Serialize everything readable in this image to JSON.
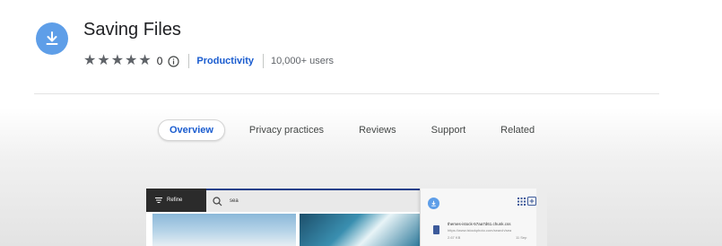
{
  "header": {
    "title": "Saving Files",
    "rating": {
      "stars_filled": 0,
      "stars_total": 5,
      "count": "0"
    },
    "category": "Productivity",
    "users": "10,000+ users",
    "accent_color": "#5e9ee8",
    "link_color": "#1a5ccf",
    "icons": [
      "download-icon",
      "star-icon",
      "info-icon"
    ]
  },
  "tabs": [
    {
      "label": "Overview",
      "active": true
    },
    {
      "label": "Privacy practices",
      "active": false
    },
    {
      "label": "Reviews",
      "active": false
    },
    {
      "label": "Support",
      "active": false
    },
    {
      "label": "Related",
      "active": false
    }
  ],
  "screenshot": {
    "refine_label": "Refine",
    "search_text": "sea",
    "popup": {
      "file_name": "themes-istock-57aa7d61.chunk.css",
      "file_url": "https://www.istockphoto.com/search/sea",
      "file_size": "2.67 KB",
      "file_date": "11 Sep"
    }
  }
}
